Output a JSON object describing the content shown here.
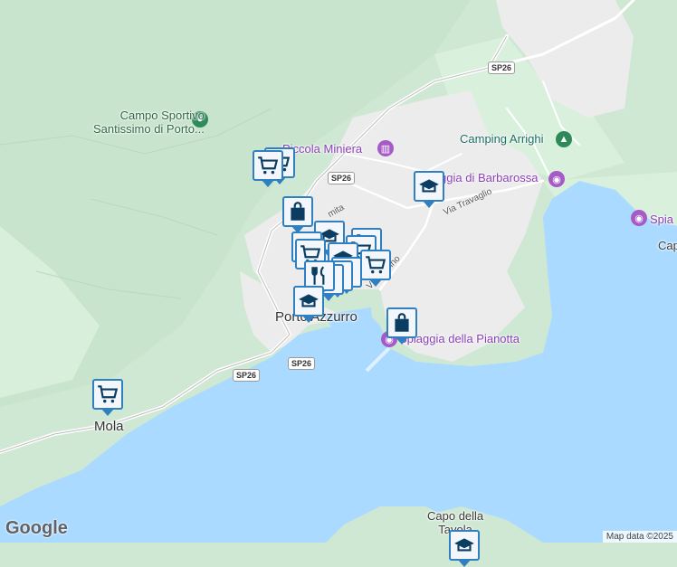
{
  "places": {
    "campo_sportivo": "Campo Sportivo\nSantissimo di Porto...",
    "piccola_miniera": "Piccola Miniera",
    "camping_arrighi": "Camping Arrighi",
    "spiaggia_barbarossa": "Spiaggia di Barbarossa",
    "spiaggia_right": "Spia",
    "cap_right": "Cap",
    "porto_azzurro": "Porto Azzurro",
    "spiaggia_pianotta": "Spiaggia della Pianotta",
    "mola": "Mola",
    "capo_della_tavola": "Capo della\nTavola"
  },
  "streets": {
    "via_travaglio": "Via Travaglio",
    "via_marino": "Via Marino",
    "via_mita": "mita"
  },
  "road_shields": {
    "sp26_top": "SP26",
    "sp26_mid": "SP26",
    "sp26_lower": "SP26",
    "sp26_left": "SP26"
  },
  "icons": {
    "cart": "shopping-cart-icon",
    "bag": "shopping-bag-icon",
    "school": "school-icon",
    "restaurant": "restaurant-icon"
  },
  "colors": {
    "land": "#cfe8d3",
    "urban": "#eeeeee",
    "water": "#aadaff",
    "pin_border": "#2f7fc1",
    "pin_icon": "#0b3d63"
  },
  "footer": {
    "logo": "Google",
    "attribution": "Map data ©2025"
  }
}
